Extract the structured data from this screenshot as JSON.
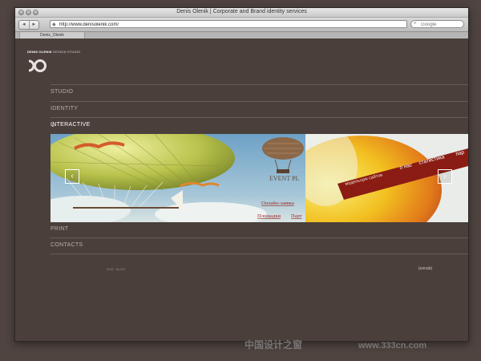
{
  "window": {
    "title": "Denis Olenik | Corporate and Brand identity services",
    "tab_label": "Denis_Olenik"
  },
  "toolbar": {
    "back_glyph": "◂",
    "forward_glyph": "▸",
    "url": "http://www.denisolenik.com/",
    "search_placeholder": "Google"
  },
  "site": {
    "logo_name": "DENIS OLENIK",
    "logo_sub": "DESIGN STUDIO",
    "menu": [
      {
        "label": "STUDIO"
      },
      {
        "label": "IDENTITY"
      },
      {
        "label": "INTERACTIVE",
        "active": true,
        "chevron": "⌄"
      },
      {
        "label": "PRINT"
      },
      {
        "label": "CONTACTS"
      }
    ],
    "slider": {
      "prev_glyph": "‹",
      "next_glyph": "›",
      "slide_a": {
        "brand": "EVENT PL",
        "link_order": "Онлайн-заявка",
        "link_venues": "Площадки",
        "link_partners": "Парт"
      },
      "slide_b": {
        "tabs": [
          "о нас",
          "статистика",
          "пар"
        ],
        "side_text": "модельщик сайтов"
      }
    },
    "footer": {
      "links": "RUS  ·  BLOG",
      "right": "(ennab)"
    }
  },
  "watermark": {
    "cn": "中国设计之窗",
    "url": "www.333cn.com"
  },
  "colors": {
    "background": "#4f4440",
    "page": "#4a3f3b",
    "menu_text": "#b9b0ac",
    "active_text": "#ffffff",
    "divider": "#685c57"
  }
}
